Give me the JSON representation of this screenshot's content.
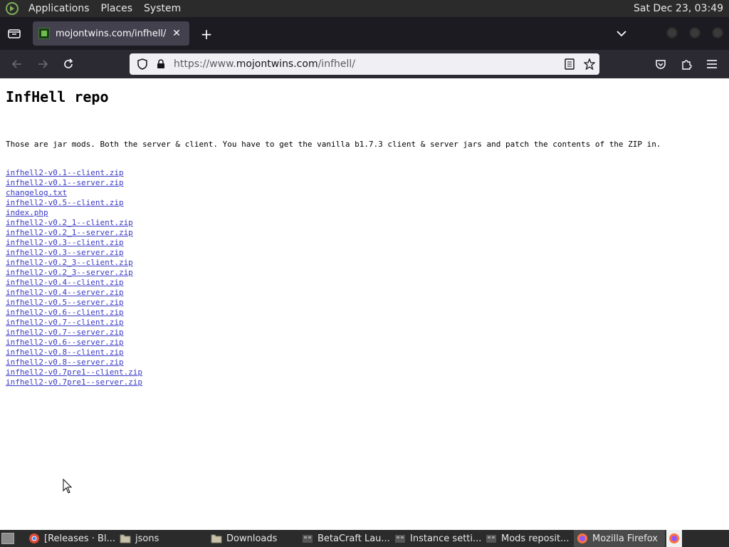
{
  "system_panel": {
    "menus": [
      "Applications",
      "Places",
      "System"
    ],
    "clock": "Sat Dec 23, 03:49"
  },
  "browser": {
    "tab_title": "mojontwins.com/infhell/",
    "url_prefix": "https://www.",
    "url_domain": "mojontwins.com",
    "url_path": "/infhell/"
  },
  "page": {
    "heading": "InfHell repo",
    "description": "Those are jar mods. Both the server & client. You have to get the vanilla b1.7.3 client & server jars and patch the contents of the ZIP in.",
    "files": [
      "infhell2-v0.1--client.zip",
      "infhell2-v0.1--server.zip",
      "changelog.txt",
      "infhell2-v0.5--client.zip",
      "index.php",
      "infhell2-v0.2_1--client.zip",
      "infhell2-v0.2_1--server.zip",
      "infhell2-v0.3--client.zip",
      "infhell2-v0.3--server.zip",
      "infhell2-v0.2_3--client.zip",
      "infhell2-v0.2_3--server.zip",
      "infhell2-v0.4--client.zip",
      "infhell2-v0.4--server.zip",
      "infhell2-v0.5--server.zip",
      "infhell2-v0.6--client.zip",
      "infhell2-v0.7--client.zip",
      "infhell2-v0.7--server.zip",
      "infhell2-v0.6--server.zip",
      "infhell2-v0.8--client.zip",
      "infhell2-v0.8--server.zip",
      "infhell2-v0.7pre1--client.zip",
      "infhell2-v0.7pre1--server.zip"
    ]
  },
  "taskbar": {
    "items": [
      {
        "label": "[Releases · Bl...",
        "icon": "chrome-icon"
      },
      {
        "label": "jsons",
        "icon": "folder-icon"
      },
      {
        "label": "Downloads",
        "icon": "folder-icon"
      },
      {
        "label": "BetaCraft Lau...",
        "icon": "app-icon"
      },
      {
        "label": "Instance setti...",
        "icon": "app-icon"
      },
      {
        "label": "Mods reposit...",
        "icon": "app-icon"
      },
      {
        "label": "Mozilla Firefox",
        "icon": "firefox-icon"
      }
    ]
  }
}
